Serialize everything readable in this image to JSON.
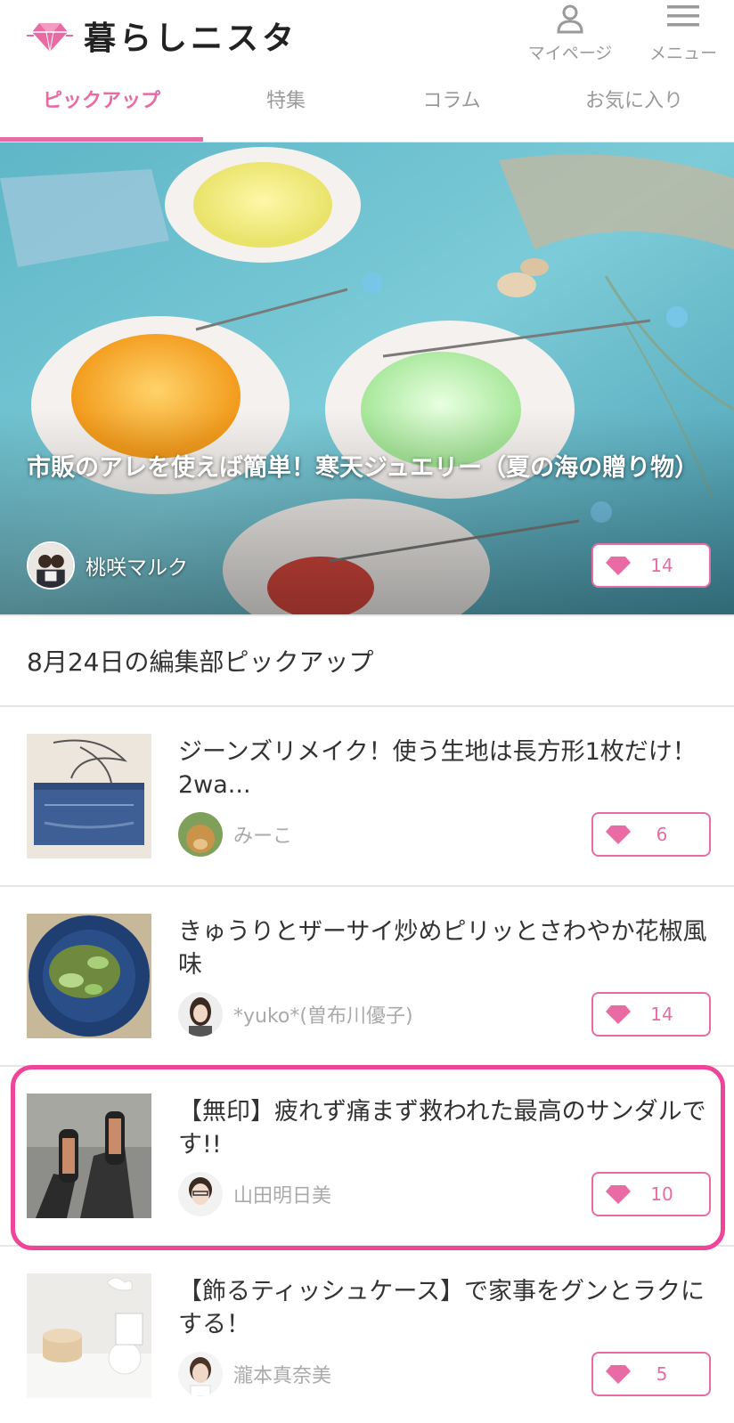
{
  "header": {
    "logo_text": "暮らしニスタ",
    "mypage_label": "マイページ",
    "menu_label": "メニュー"
  },
  "tabs": [
    {
      "label": "ピックアップ",
      "active": true
    },
    {
      "label": "特集",
      "active": false
    },
    {
      "label": "コラム",
      "active": false
    },
    {
      "label": "お気に入り",
      "active": false
    }
  ],
  "hero": {
    "title": "市販のアレを使えば簡単！寒天ジュエリー（夏の海の贈り物）",
    "author": "桃咲マルク",
    "likes": "14"
  },
  "section": {
    "title": "8月24日の編集部ピックアップ"
  },
  "articles": [
    {
      "title": "ジーンズリメイク！使う生地は長方形1枚だけ！2wa...",
      "author": "みーこ",
      "likes": "6"
    },
    {
      "title": "きゅうりとザーサイ炒めピリッとさわやか花椒風味",
      "author": "*yuko*(曽布川優子)",
      "likes": "14"
    },
    {
      "title": "【無印】疲れず痛まず救われた最高のサンダルです!!",
      "author": "山田明日美",
      "likes": "10"
    },
    {
      "title": "【飾るティッシュケース】で家事をグンとラクにする！",
      "author": "瀧本真奈美",
      "likes": "5"
    }
  ],
  "colors": {
    "accent": "#e86ba3",
    "highlight": "#f0439a"
  }
}
